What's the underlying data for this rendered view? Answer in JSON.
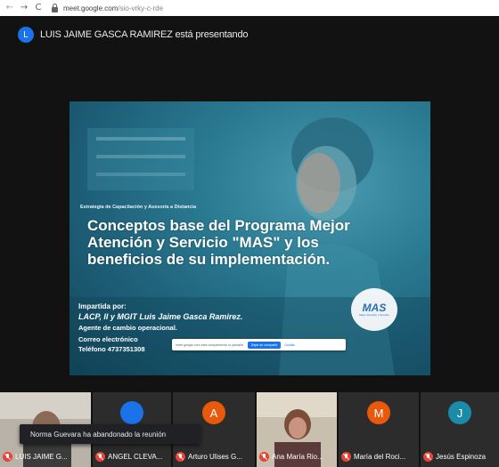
{
  "browser": {
    "url_host": "meet.google.com",
    "url_path": "/sio-vrky-c-rde",
    "back_icon": "←",
    "forward_icon": "→",
    "reload_icon": "C"
  },
  "presenter": {
    "initial": "L",
    "text": "LUIS JAIME GASCA RAMIREZ está presentando",
    "avatar_color": "#1a73e8"
  },
  "slide": {
    "subtitle": "Estrategia de Capacitación y Asesoría a Distancia",
    "title_line1": "Conceptos base del Programa Mejor",
    "title_line2": "Atención y Servicio \"MAS\" y los",
    "title_line3": "beneficios de su implementación.",
    "impartida": "Impartida por:",
    "instructor": "LACP, II y MGIT Luis Jaime Gasca Ramirez.",
    "role": "Agente de cambio operacional.",
    "email": "Correo electrónico",
    "phone": "Teléfono 4737351308",
    "logo_text": "MAS",
    "logo_sub": "Mejor Atención y Servicio"
  },
  "share_bar": {
    "message": "meet.google.com está compartiendo tu pantalla.",
    "stop_label": "Dejar de compartir",
    "hide_label": "Ocultar"
  },
  "notification": {
    "text": "Norma Guevara ha abandonado la reunión"
  },
  "participants": [
    {
      "name": "LUIS JAIME G...",
      "has_video": true,
      "initial": "",
      "color": ""
    },
    {
      "name": "ANGEL CLEVA...",
      "has_video": false,
      "initial": "",
      "color": "#1a73e8"
    },
    {
      "name": "Arturo Ulises G...",
      "has_video": false,
      "initial": "A",
      "color": "#e8590c"
    },
    {
      "name": "Ana María Rio...",
      "has_video": true,
      "initial": "",
      "color": ""
    },
    {
      "name": "María del Roci...",
      "has_video": false,
      "initial": "M",
      "color": "#e8590c"
    },
    {
      "name": "Jesús Espinoza",
      "has_video": false,
      "initial": "J",
      "color": "#1a8ca8"
    }
  ]
}
